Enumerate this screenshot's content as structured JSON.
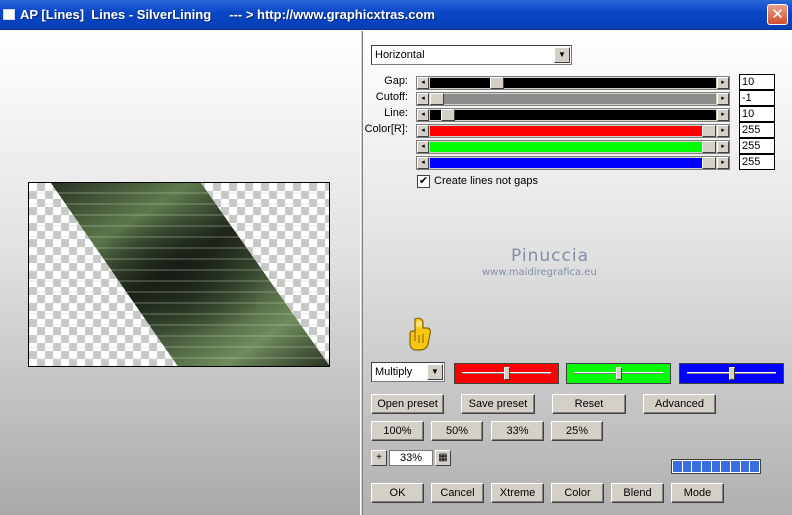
{
  "window": {
    "title": "AP [Lines]  Lines - SilverLining     --- > http://www.graphicxtras.com",
    "close_glyph": "✕"
  },
  "controls": {
    "orientation": {
      "value": "Horizontal",
      "arrow": "▼"
    },
    "sliders": [
      {
        "label": "Gap:",
        "value": "10",
        "fill": "#000000",
        "position": 0.22
      },
      {
        "label": "Cutoff:",
        "value": "-1",
        "fill": "#8c8c8c",
        "position": 0.0
      },
      {
        "label": "Line:",
        "value": "10",
        "fill": "#000000",
        "position": 0.04
      },
      {
        "label": "Color[R]:",
        "value": "255",
        "fill": "#ff0000",
        "position": 1.0
      },
      {
        "label": "",
        "value": "255",
        "fill": "#00ff00",
        "position": 1.0
      },
      {
        "label": "",
        "value": "255",
        "fill": "#0000ff",
        "position": 1.0
      }
    ],
    "arrow_left": "◂",
    "arrow_right": "▸",
    "create_lines": {
      "label": "Create lines not gaps",
      "checked": true,
      "mark": "✔"
    }
  },
  "watermark": {
    "name": "Pinuccia",
    "site": "www.maidiregrafica.eu"
  },
  "blend": {
    "mode": "Multiply",
    "arrow": "▼",
    "red": {
      "color": "#ff0000",
      "position": 0.5
    },
    "green": {
      "color": "#00ff00",
      "position": 0.5
    },
    "blue": {
      "color": "#0000ff",
      "position": 0.5
    }
  },
  "buttons": {
    "open_preset": "Open preset",
    "save_preset": "Save preset",
    "reset": "Reset",
    "advanced": "Advanced",
    "zoom100": "100%",
    "zoom50": "50%",
    "zoom33": "33%",
    "zoom25": "25%",
    "ok": "OK",
    "cancel": "Cancel",
    "xtreme": "Xtreme",
    "color": "Color",
    "blend": "Blend",
    "mode": "Mode"
  },
  "zoom": {
    "plus": "+",
    "value": "33%",
    "grid_icon": "▦"
  },
  "progress": {
    "segments": 9,
    "fraction": 1.0
  }
}
